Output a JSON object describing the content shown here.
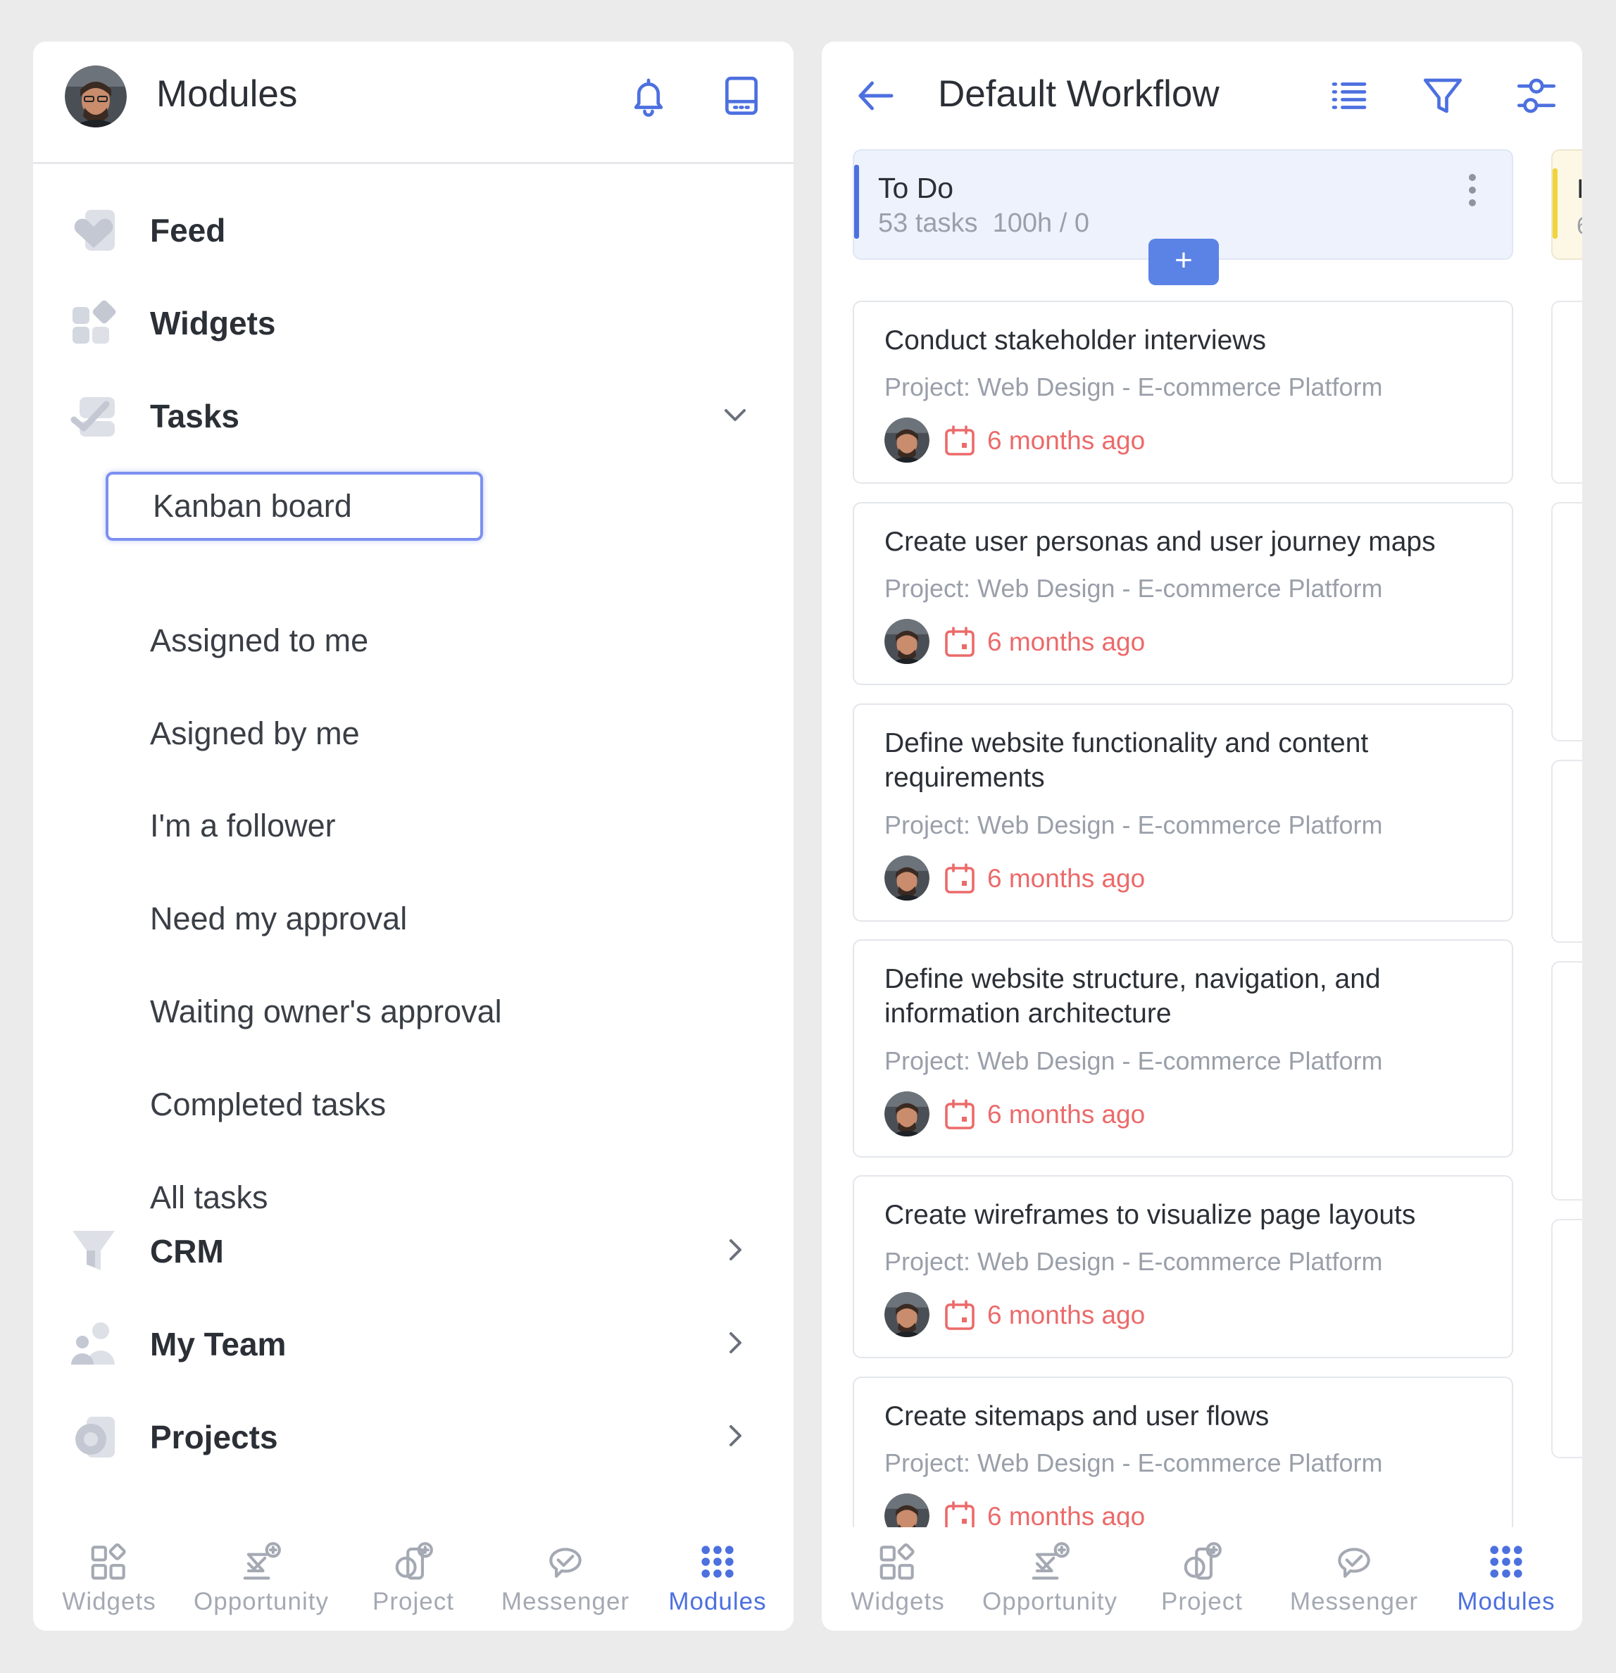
{
  "left": {
    "header": {
      "title": "Modules",
      "bell_icon": "bell-icon",
      "layout_icon": "tablet-layout-icon"
    },
    "modules": [
      {
        "label": "Feed",
        "icon": "feed-heart-icon"
      },
      {
        "label": "Widgets",
        "icon": "widgets-grid-icon"
      },
      {
        "label": "Tasks",
        "icon": "tasks-check-icon"
      },
      {
        "label": "CRM",
        "icon": "crm-funnel-icon"
      },
      {
        "label": "My Team",
        "icon": "team-people-icon"
      },
      {
        "label": "Projects",
        "icon": "projects-icon"
      }
    ],
    "task_items": [
      "Kanban board",
      "Assigned to me",
      "Asigned by me",
      "I'm a follower",
      "Need my approval",
      "Waiting owner's approval",
      "Completed tasks",
      "All tasks"
    ],
    "active_task_item": "Kanban board"
  },
  "right": {
    "header": {
      "title": "Default Workflow"
    },
    "column": {
      "title": "To Do",
      "tasks_count": "53 tasks",
      "hours": "100h / 0",
      "add_label": "+"
    },
    "next_column_peek": {
      "title": "I",
      "sub": "6"
    },
    "tasks": [
      {
        "title": "Conduct stakeholder interviews",
        "project": "Project: Web Design - E-commerce Platform",
        "date": "6 months ago"
      },
      {
        "title": "Create user personas and user journey maps",
        "project": "Project: Web Design - E-commerce Platform",
        "date": "6 months ago"
      },
      {
        "title": "Define website functionality and content requirements",
        "project": "Project: Web Design - E-commerce Platform",
        "date": "6 months ago"
      },
      {
        "title": "Define website structure, navigation, and information architecture",
        "project": "Project: Web Design - E-commerce Platform",
        "date": "6 months ago"
      },
      {
        "title": "Create wireframes to visualize page layouts",
        "project": "Project: Web Design - E-commerce Platform",
        "date": "6 months ago"
      },
      {
        "title": "Create sitemaps and user flows",
        "project": "Project: Web Design - E-commerce Platform",
        "date": "6 months ago"
      }
    ]
  },
  "bottom_nav": {
    "items": [
      "Widgets",
      "Opportunity",
      "Project",
      "Messenger",
      "Modules"
    ],
    "active": "Modules"
  },
  "colors": {
    "accent": "#4d70df",
    "date_red": "#ec6a6a",
    "muted_text": "#9aa0aa",
    "column_yellow": "#f1d43d"
  }
}
